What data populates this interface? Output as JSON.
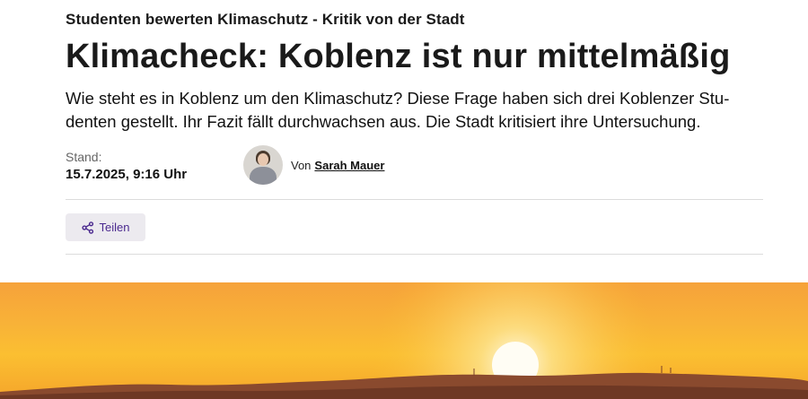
{
  "article": {
    "kicker": "Studenten bewerten Klimaschutz - Kritik von der Stadt",
    "headline": "Klimacheck: Koblenz ist nur mittelmäßig",
    "teaser": "Wie steht es in Koblenz um den Klimaschutz? Diese Frage haben sich drei Koblenzer Stu-denten gestellt. Ihr Fazit fällt durchwachsen aus. Die Stadt kritisiert ihre Untersuchung."
  },
  "meta": {
    "stand_label": "Stand:",
    "stand_date": "15.7.2025, 9:16 Uhr",
    "author_prefix": "Von",
    "author_name": "Sarah Mauer"
  },
  "actions": {
    "share_label": "Teilen",
    "share_icon": "share-icon"
  },
  "hero_image": {
    "subject": "sunset-over-hills"
  },
  "colors": {
    "accent": "#4b2a8f",
    "share_bg": "#eceaef",
    "divider": "#dcdcdc"
  }
}
